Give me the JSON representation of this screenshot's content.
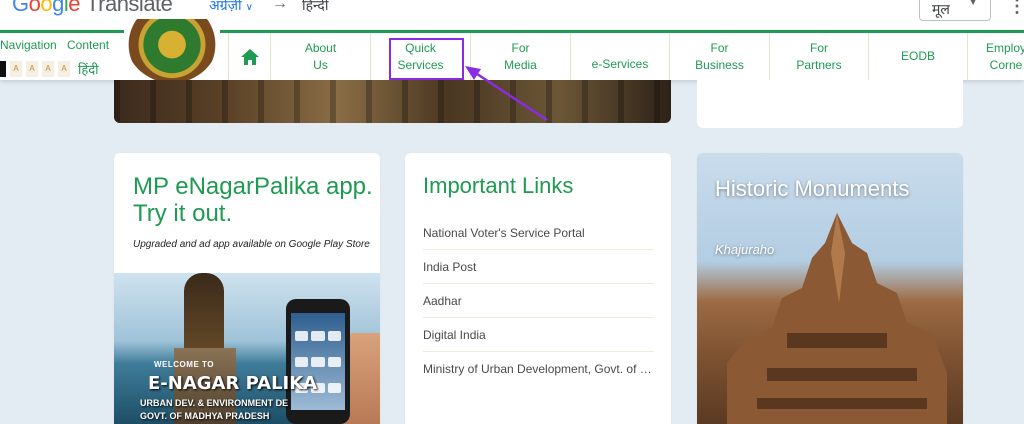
{
  "google_translate": {
    "logo": [
      "G",
      "o",
      "o",
      "g",
      "l",
      "e"
    ],
    "product": "Translate",
    "source_lang": "अंग्रेज़ी",
    "target_lang": "हिन्दी",
    "original_label": "मूल",
    "accent": "#1a73e8"
  },
  "utility": {
    "navigation": "Navigation",
    "content": "Content",
    "font_sizes": [
      "A",
      "A",
      "A",
      "A"
    ],
    "hindi": "हिंदी"
  },
  "nav": {
    "home_icon": "home-icon",
    "items": [
      {
        "label": "About\nUs"
      },
      {
        "label": "Quick\nServices",
        "highlighted": true
      },
      {
        "label": "For\nMedia"
      },
      {
        "label": "e-Services"
      },
      {
        "label": "For\nBusiness"
      },
      {
        "label": "For\nPartners"
      },
      {
        "label": "EODB"
      },
      {
        "label": "Employ\nCorne"
      }
    ],
    "accent": "#1f9a53",
    "highlight_color": "#8a2be2"
  },
  "app_card": {
    "title": "MP eNagarPalika app. Try it out.",
    "subtitle": "Upgraded and ad app available on Google Play Store",
    "banner_welcome": "WELCOME TO",
    "banner_title": "E-NAGAR PALIKA",
    "banner_sub_1": "URBAN DEV. & ENVIRONMENT DE",
    "banner_sub_2": "GOVT. OF MADHYA PRADESH"
  },
  "links_card": {
    "title": "Important Links",
    "items": [
      "National Voter's Service Portal",
      "India Post",
      "Aadhar",
      "Digital India",
      "Ministry of Urban Development, Govt. of India"
    ]
  },
  "monuments_card": {
    "title": "Historic Monuments",
    "subtitle": "Khajuraho"
  }
}
